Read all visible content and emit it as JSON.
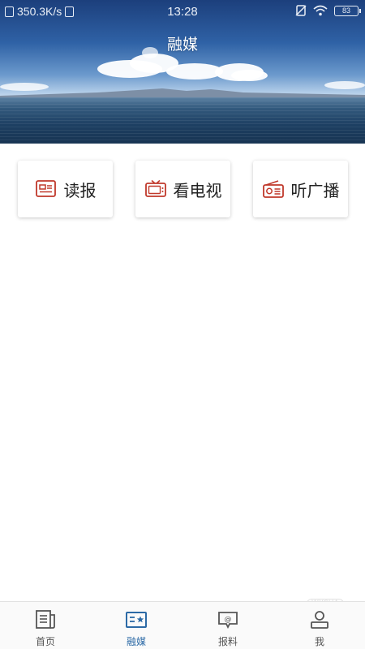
{
  "status_bar": {
    "network_speed": "350.3K/s",
    "time": "13:28",
    "battery": "83"
  },
  "header": {
    "title": "融媒"
  },
  "cards": [
    {
      "label": "读报",
      "icon": "newspaper-icon"
    },
    {
      "label": "看电视",
      "icon": "tv-icon"
    },
    {
      "label": "听广播",
      "icon": "radio-icon"
    }
  ],
  "bottom_nav": {
    "items": [
      {
        "label": "首页",
        "icon": "news-icon",
        "active": false
      },
      {
        "label": "融媒",
        "icon": "media-card-icon",
        "active": true
      },
      {
        "label": "报料",
        "icon": "report-chat-icon",
        "active": false
      },
      {
        "label": "我",
        "icon": "user-icon",
        "active": false
      }
    ]
  },
  "watermark": {
    "text": "微茶",
    "tag": "WXCHA"
  },
  "colors": {
    "accent": "#2c6aa6",
    "card_icon": "#c0392b",
    "nav_inactive": "#555555"
  }
}
